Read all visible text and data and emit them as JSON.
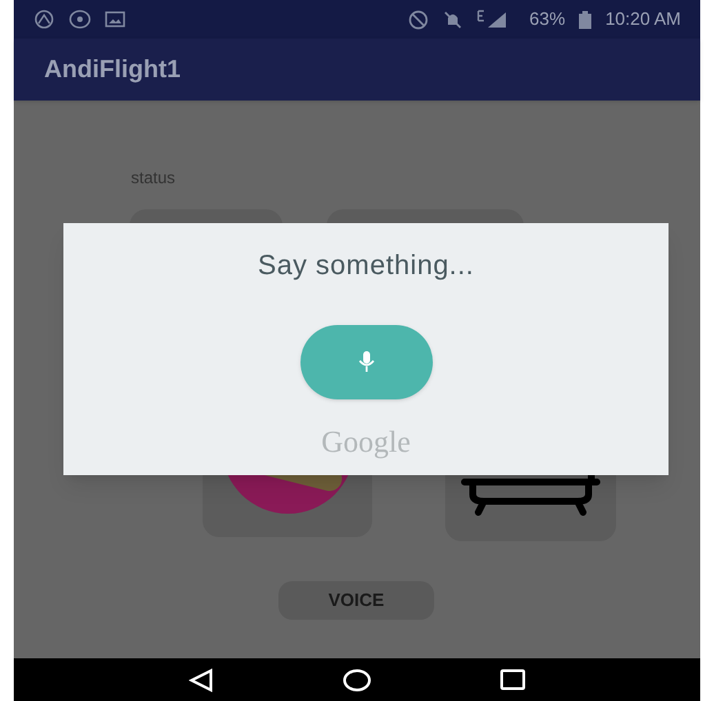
{
  "status_bar": {
    "battery": "63%",
    "time": "10:20 AM"
  },
  "app_bar": {
    "title": "AndiFlight1"
  },
  "content": {
    "status_label": "status",
    "voice_button": "VOICE"
  },
  "dialog": {
    "prompt": "Say something...",
    "brand": "Google"
  }
}
